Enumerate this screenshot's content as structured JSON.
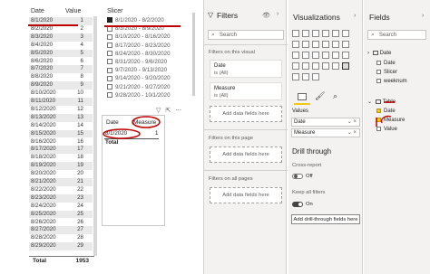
{
  "table": {
    "col_date": "Date",
    "col_value": "Value",
    "rows": [
      {
        "date": "8/1/2020",
        "value": "1"
      },
      {
        "date": "8/2/2020",
        "value": "2"
      },
      {
        "date": "8/3/2020",
        "value": "3"
      },
      {
        "date": "8/4/2020",
        "value": "4"
      },
      {
        "date": "8/5/2020",
        "value": "5"
      },
      {
        "date": "8/6/2020",
        "value": "6"
      },
      {
        "date": "8/7/2020",
        "value": "7"
      },
      {
        "date": "8/8/2020",
        "value": "8"
      },
      {
        "date": "8/9/2020",
        "value": "9"
      },
      {
        "date": "8/10/2020",
        "value": "10"
      },
      {
        "date": "8/11/2020",
        "value": "11"
      },
      {
        "date": "8/12/2020",
        "value": "12"
      },
      {
        "date": "8/13/2020",
        "value": "13"
      },
      {
        "date": "8/14/2020",
        "value": "14"
      },
      {
        "date": "8/15/2020",
        "value": "15"
      },
      {
        "date": "8/16/2020",
        "value": "16"
      },
      {
        "date": "8/17/2020",
        "value": "17"
      },
      {
        "date": "8/18/2020",
        "value": "18"
      },
      {
        "date": "8/19/2020",
        "value": "19"
      },
      {
        "date": "8/20/2020",
        "value": "20"
      },
      {
        "date": "8/21/2020",
        "value": "21"
      },
      {
        "date": "8/22/2020",
        "value": "22"
      },
      {
        "date": "8/23/2020",
        "value": "23"
      },
      {
        "date": "8/24/2020",
        "value": "24"
      },
      {
        "date": "8/25/2020",
        "value": "25"
      },
      {
        "date": "8/26/2020",
        "value": "26"
      },
      {
        "date": "8/27/2020",
        "value": "27"
      },
      {
        "date": "8/28/2020",
        "value": "28"
      },
      {
        "date": "8/29/2020",
        "value": "29"
      }
    ],
    "total_label": "Total",
    "total_value": "1953"
  },
  "slicer": {
    "title": "Slicer",
    "items": [
      {
        "label": "8/1/2020 - 8/2/2020",
        "checked": true
      },
      {
        "label": "8/3/2020 - 8/9/2020",
        "checked": false
      },
      {
        "label": "8/10/2020 - 8/16/2020",
        "checked": false
      },
      {
        "label": "8/17/2020 - 8/23/2020",
        "checked": false
      },
      {
        "label": "8/24/2020 - 8/30/2020",
        "checked": false
      },
      {
        "label": "8/31/2020 - 9/6/2020",
        "checked": false
      },
      {
        "label": "9/7/2020 - 9/13/2020",
        "checked": false
      },
      {
        "label": "9/14/2020 - 9/20/2020",
        "checked": false
      },
      {
        "label": "9/21/2020 - 9/27/2020",
        "checked": false
      },
      {
        "label": "9/28/2020 - 10/1/2020",
        "checked": false
      }
    ]
  },
  "visual2": {
    "col_date": "Date",
    "col_measure": "Measure",
    "row_date": "8/1/2020",
    "row_value": "1",
    "total_label": "Total"
  },
  "filters": {
    "title": "Filters",
    "search_placeholder": "Search",
    "on_visual_label": "Filters on this visual",
    "card1_title": "Date",
    "card1_sub": "is (All)",
    "card2_title": "Measure",
    "card2_sub": "is (All)",
    "add_fields": "Add data fields here",
    "on_page_label": "Filters on this page",
    "on_all_pages_label": "Filters on all pages"
  },
  "visualizations": {
    "title": "Visualizations",
    "values_label": "Values",
    "value_fields": [
      "Date",
      "Measure"
    ],
    "drill_title": "Drill through",
    "cross_report": "Cross-report",
    "off_label": "Off",
    "keep_filters": "Keep all filters",
    "on_label": "On",
    "add_drill": "Add drill-through fields here"
  },
  "fields": {
    "title": "Fields",
    "search_placeholder": "Search",
    "groups": [
      {
        "name": "Date",
        "children": [
          {
            "name": "Date",
            "checked": false
          },
          {
            "name": "Slicer",
            "checked": false
          },
          {
            "name": "weeknum",
            "checked": false
          }
        ]
      },
      {
        "name": "Table",
        "children": [
          {
            "name": "Date",
            "checked": true
          },
          {
            "name": "Measure",
            "checked": true
          },
          {
            "name": "Value",
            "checked": false
          }
        ]
      }
    ]
  },
  "colors": {
    "annotation_red": "#c00000",
    "accent_yellow": "#f2c811"
  }
}
